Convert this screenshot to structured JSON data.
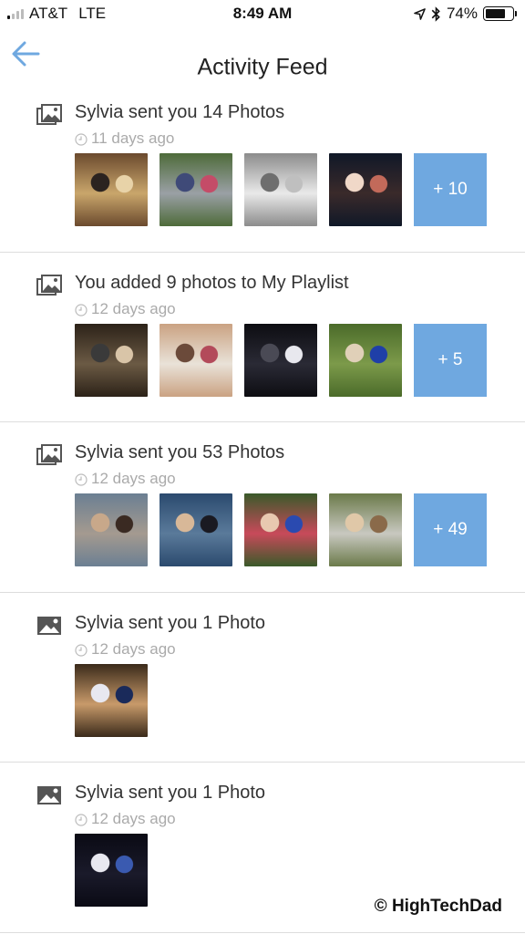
{
  "status_bar": {
    "carrier": "AT&T",
    "network": "LTE",
    "time": "8:49 AM",
    "battery_pct": "74%",
    "battery_level": 0.74,
    "signal_bars_on": 1,
    "signal_bars_total": 4
  },
  "nav": {
    "back_icon": "arrow-left-icon",
    "title": "Activity Feed",
    "accent_color": "#6fa8e0"
  },
  "feed": [
    {
      "icon": "multi-image-icon",
      "title": "Sylvia sent you 14 Photos",
      "time": "11 days ago",
      "thumbnails": [
        {
          "desc": "two girls smiling",
          "colors": [
            "#6b4a2e",
            "#c9a66b",
            "#e8d3a8",
            "#2b2320"
          ]
        },
        {
          "desc": "girls in dresses on stairs",
          "colors": [
            "#4e6b3a",
            "#9aa0a5",
            "#c44c68",
            "#3f4a78"
          ]
        },
        {
          "desc": "dancer in window",
          "colors": [
            "#8c8c8c",
            "#e9e9e9",
            "#bfbfbf",
            "#6e6e6e"
          ]
        },
        {
          "desc": "girls with mouse ears",
          "colors": [
            "#101828",
            "#3a2a2a",
            "#c26a5a",
            "#f0d8c8"
          ]
        }
      ],
      "more_label": "+ 10"
    },
    {
      "icon": "multi-image-icon",
      "title": "You added 9 photos to My Playlist",
      "time": "12 days ago",
      "thumbnails": [
        {
          "desc": "elderly couple",
          "colors": [
            "#2c2218",
            "#6b5a44",
            "#d9c5a8",
            "#3a3a3a"
          ]
        },
        {
          "desc": "girl on carousel horse",
          "colors": [
            "#caa282",
            "#e9e2d8",
            "#b34a5a",
            "#6b4a3a"
          ]
        },
        {
          "desc": "ballet leap on stage",
          "colors": [
            "#0d0d12",
            "#2a2a35",
            "#e8e8ee",
            "#4a4a55"
          ]
        },
        {
          "desc": "graduate in blue gown",
          "colors": [
            "#4b6b2a",
            "#7c9a4a",
            "#1f3fa8",
            "#e0d0b8"
          ]
        }
      ],
      "more_label": "+ 5"
    },
    {
      "icon": "multi-image-icon",
      "title": "Sylvia sent you 53 Photos",
      "time": "12 days ago",
      "thumbnails": [
        {
          "desc": "group selfie at beach",
          "colors": [
            "#6b7f92",
            "#a49a90",
            "#3a2a22",
            "#c8a88a"
          ]
        },
        {
          "desc": "girl with glasses by sea",
          "colors": [
            "#2b4a6e",
            "#5a7a9a",
            "#1a1a22",
            "#d8b898"
          ]
        },
        {
          "desc": "graduation group",
          "colors": [
            "#3a5a2a",
            "#c84a5a",
            "#2a4ab0",
            "#e8c8b0"
          ]
        },
        {
          "desc": "couple outdoors",
          "colors": [
            "#6b7a4a",
            "#c8c8c0",
            "#8a6a4a",
            "#e0c8a8"
          ]
        }
      ],
      "more_label": "+ 49"
    },
    {
      "icon": "single-image-icon",
      "title": "Sylvia sent you 1 Photo",
      "time": "12 days ago",
      "thumbnails": [
        {
          "desc": "three cheerleaders",
          "colors": [
            "#3a2a1a",
            "#c89a6a",
            "#1a2a5a",
            "#e8e8f0"
          ]
        }
      ],
      "more_label": null
    },
    {
      "icon": "single-image-icon",
      "title": "Sylvia sent you 1 Photo",
      "time": "12 days ago",
      "thumbnails": [
        {
          "desc": "cheer pyramid on stage",
          "colors": [
            "#0a0a14",
            "#1a1a2a",
            "#3a5ab0",
            "#e8e8f0"
          ]
        }
      ],
      "more_label": null
    }
  ],
  "watermark": "© HighTechDad"
}
